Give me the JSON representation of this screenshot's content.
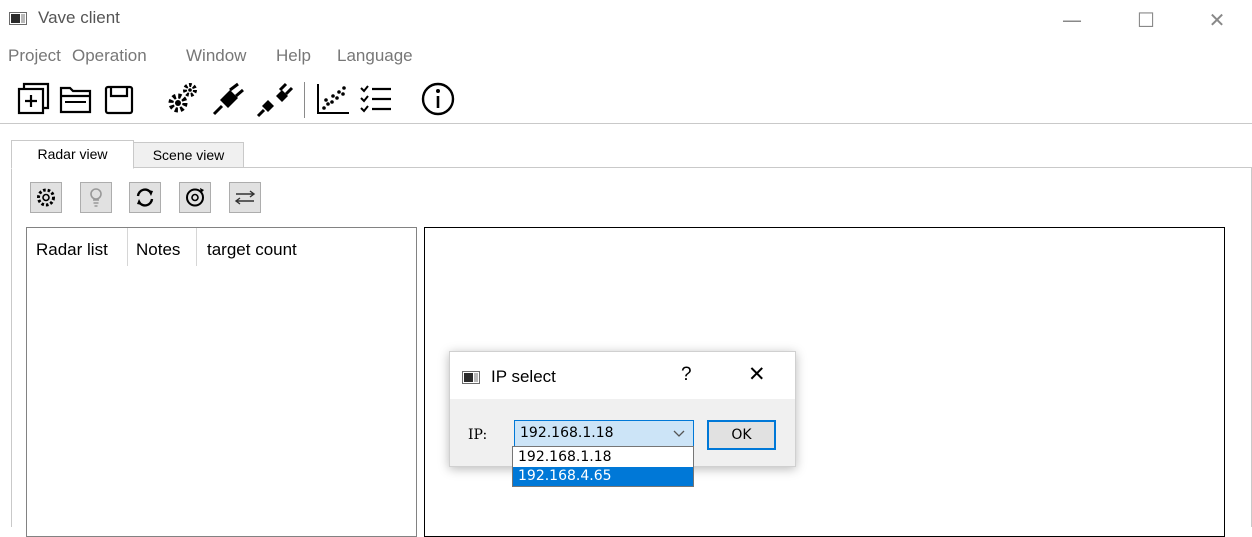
{
  "window": {
    "title": "Vave client",
    "controls": {
      "minimize": "—",
      "maximize": "☐",
      "close": "✕"
    }
  },
  "menu": {
    "items": [
      "Project",
      "Operation",
      "Window",
      "Help",
      "Language"
    ]
  },
  "toolbar": {
    "icons": [
      "new-project-icon",
      "open-folder-icon",
      "save-icon",
      "settings-gears-icon",
      "connect-plug-icon",
      "disconnect-plug-icon",
      "scatter-chart-icon",
      "checklist-icon",
      "info-icon"
    ]
  },
  "tabs": [
    {
      "label": "Radar view",
      "active": true
    },
    {
      "label": "Scene view",
      "active": false
    }
  ],
  "radar_toolbar": {
    "icons": [
      "settings-icon",
      "bulb-icon",
      "refresh-icon",
      "sync-icon",
      "swap-icon"
    ]
  },
  "radar_list": {
    "columns": [
      "Radar list",
      "Notes",
      "target count"
    ]
  },
  "dialog": {
    "title": "IP select",
    "help": "?",
    "close": "✕",
    "ip_label": "IP:",
    "selected_ip": "192.168.1.18",
    "options": [
      "192.168.1.18",
      "192.168.4.65"
    ],
    "highlighted_option": "192.168.4.65",
    "ok_label": "OK"
  },
  "colors": {
    "accent": "#0078d7",
    "highlight": "#0078d7",
    "combo_bg": "#cce4f7",
    "dialog_bg": "#f0f0f0"
  }
}
